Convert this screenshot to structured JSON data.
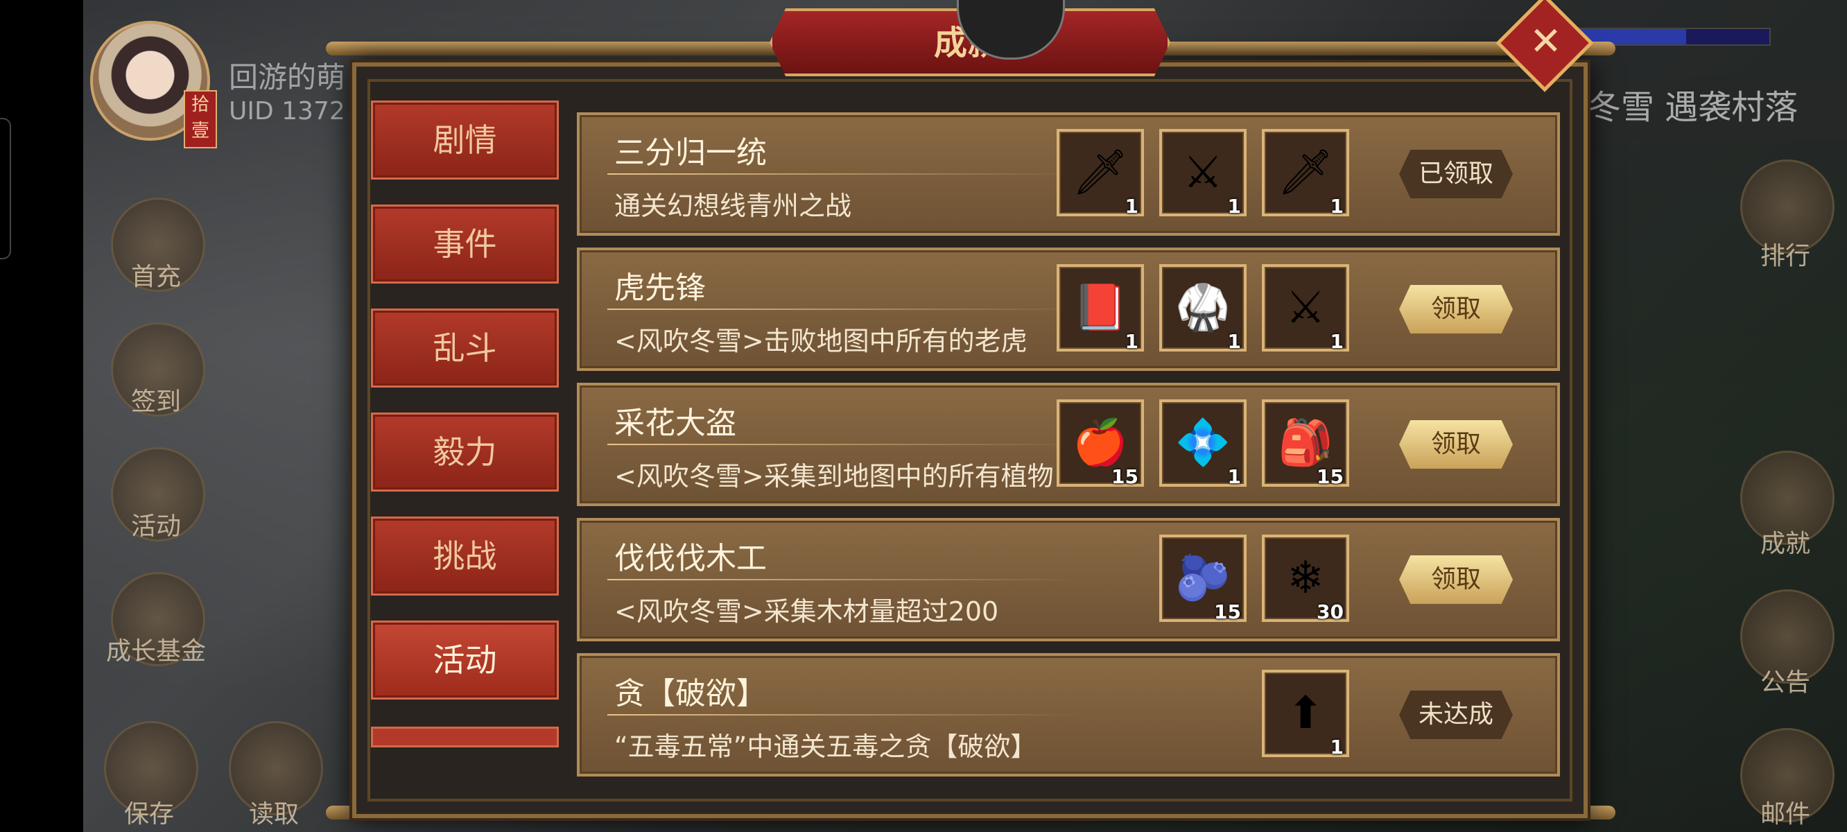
{
  "player": {
    "name": "回游的萌",
    "uid": "UID  1372",
    "tag": "拾壹"
  },
  "left_menu": [
    {
      "label": "首充"
    },
    {
      "label": "签到"
    },
    {
      "label": "活动"
    },
    {
      "label": "成长基金"
    },
    {
      "label": "保存"
    },
    {
      "label": "读取"
    }
  ],
  "right_menu": [
    {
      "label": "排行"
    },
    {
      "label": "成就"
    },
    {
      "label": "公告"
    },
    {
      "label": "邮件"
    }
  ],
  "top_right_banner": "冬雪 遇袭村落",
  "modal": {
    "title": "成就",
    "close_icon": "✕",
    "tabs": [
      {
        "label": "剧情",
        "active": false
      },
      {
        "label": "事件",
        "active": false
      },
      {
        "label": "乱斗",
        "active": false
      },
      {
        "label": "毅力",
        "active": false
      },
      {
        "label": "挑战",
        "active": false
      },
      {
        "label": "活动",
        "active": true
      }
    ],
    "achievements": [
      {
        "title": "三分归一统",
        "desc": "通关幻想线青州之战",
        "rewards": [
          {
            "icon": "spear-icon",
            "glyph": "🗡",
            "count": "1"
          },
          {
            "icon": "blade-icon",
            "glyph": "⚔",
            "count": "1"
          },
          {
            "icon": "sword-icon",
            "glyph": "🗡",
            "count": "1"
          }
        ],
        "status": "已领取"
      },
      {
        "title": "虎先锋",
        "desc": "<风吹冬雪>击败地图中所有的老虎",
        "rewards": [
          {
            "icon": "book-icon",
            "glyph": "📕",
            "count": "1"
          },
          {
            "icon": "armor-icon",
            "glyph": "🥋",
            "count": "1"
          },
          {
            "icon": "sword-icon",
            "glyph": "⚔",
            "count": "1"
          }
        ],
        "status": "领取"
      },
      {
        "title": "采花大盗",
        "desc": "<风吹冬雪>采集到地图中的所有植物",
        "rewards": [
          {
            "icon": "fruit-icon",
            "glyph": "🍎",
            "count": "15"
          },
          {
            "icon": "crystal-icon",
            "glyph": "💠",
            "count": "1"
          },
          {
            "icon": "bag-icon",
            "glyph": "🎒",
            "count": "15"
          }
        ],
        "status": "领取"
      },
      {
        "title": "伐伐伐木工",
        "desc": "<风吹冬雪>采集木材量超过200",
        "rewards": [
          {
            "icon": "berry-icon",
            "glyph": "🫐",
            "count": "15"
          },
          {
            "icon": "snowflake-icon",
            "glyph": "❄",
            "count": "30"
          }
        ],
        "status": "领取"
      },
      {
        "title": "贪【破欲】",
        "desc": "“五毒五常”中通关五毒之贪【破欲】",
        "rewards": [
          {
            "icon": "upgrade-icon",
            "glyph": "⬆",
            "count": "1"
          }
        ],
        "status": "未达成"
      }
    ]
  },
  "colors": {
    "tab_bg": "#b33a2a",
    "row_bg": "#7d5e3c",
    "claim_btn": "#e7cf86",
    "claimed_btn": "#4a3522",
    "title_plate": "#a42626"
  }
}
